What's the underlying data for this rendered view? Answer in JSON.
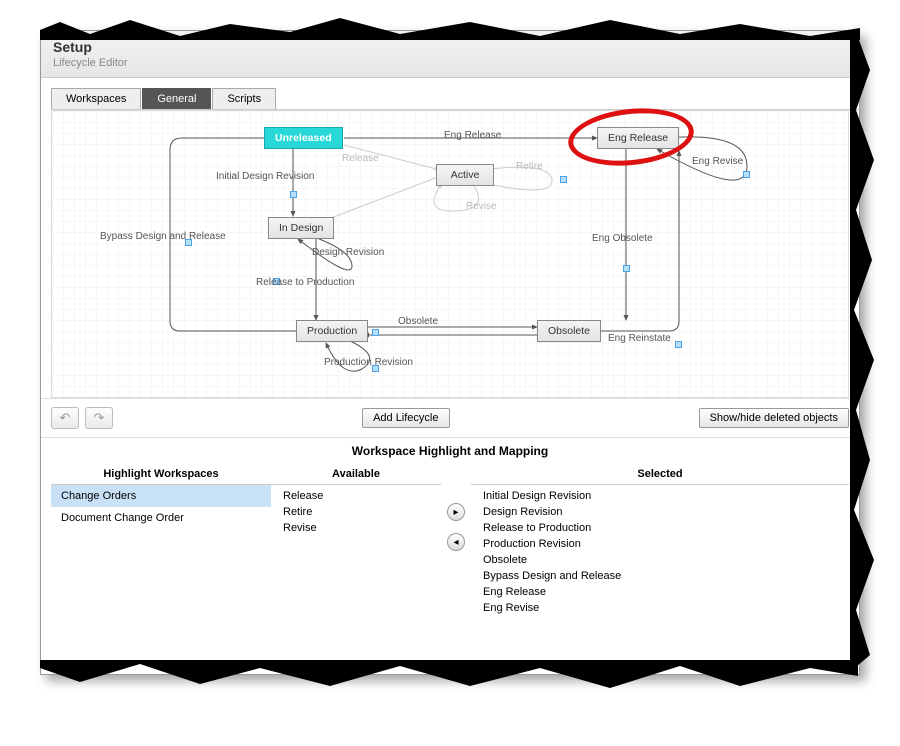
{
  "header": {
    "title": "Setup",
    "subtitle": "Lifecycle Editor"
  },
  "tabs": {
    "workspaces": "Workspaces",
    "general": "General",
    "scripts": "Scripts",
    "active": "general"
  },
  "states": {
    "unreleased": "Unreleased",
    "active": "Active",
    "in_design": "In Design",
    "production": "Production",
    "obsolete": "Obsolete",
    "eng_release": "Eng Release"
  },
  "transitions": {
    "eng_release": "Eng Release",
    "release": "Release",
    "initial_design_revision": "Initial Design Revision",
    "retire": "Retire",
    "revise": "Revise",
    "design_revision": "Design Revision",
    "bypass": "Bypass Design and Release",
    "release_to_production": "Release to Production",
    "eng_obsolete": "Eng Obsolete",
    "eng_revise": "Eng Revise",
    "obsolete": "Obsolete",
    "eng_reinstate": "Eng Reinstate",
    "production_revision": "Production Revision"
  },
  "toolbar": {
    "add_lifecycle": "Add Lifecycle",
    "show_hide": "Show/hide deleted objects"
  },
  "mapping": {
    "title": "Workspace Highlight and Mapping",
    "col_ws": "Highlight Workspaces",
    "col_available": "Available",
    "col_selected": "Selected",
    "workspaces": [
      "Change Orders",
      "Document Change Order"
    ],
    "selected_ws_index": 0,
    "available": [
      "Release",
      "Retire",
      "Revise"
    ],
    "selected": [
      "Initial Design Revision",
      "Design Revision",
      "Release to Production",
      "Production Revision",
      "Obsolete",
      "Bypass Design and Release",
      "Eng Release",
      "Eng Revise"
    ]
  }
}
